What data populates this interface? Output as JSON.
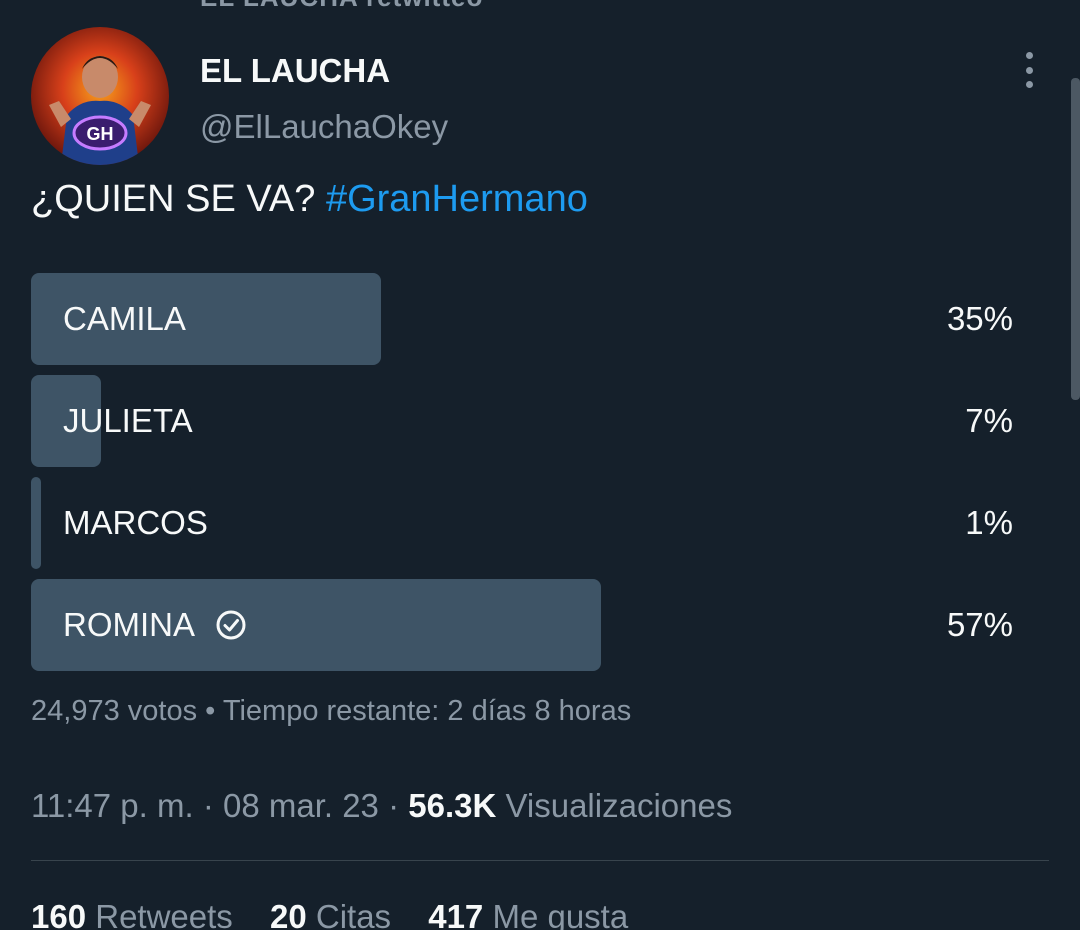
{
  "header_cut_text": "EL LAUCHA retwitteó",
  "author": {
    "display_name": "EL LAUCHA",
    "handle": "@ElLauchaOkey",
    "avatar_badge": "GH"
  },
  "tweet": {
    "text": "¿QUIEN SE VA? ",
    "hashtag": "#GranHermano"
  },
  "poll": {
    "options": [
      {
        "label": "CAMILA",
        "percent_text": "35%",
        "percent": 35,
        "winner": false
      },
      {
        "label": "JULIETA",
        "percent_text": "7%",
        "percent": 7,
        "winner": false
      },
      {
        "label": "MARCOS",
        "percent_text": "1%",
        "percent": 1,
        "winner": false
      },
      {
        "label": "ROMINA",
        "percent_text": "57%",
        "percent": 57,
        "winner": true
      }
    ],
    "votes": "24,973 votos",
    "separator": " • ",
    "time_remaining": "Tiempo restante: 2 días 8 horas"
  },
  "meta": {
    "time": "11:47 p. m.",
    "dot": " · ",
    "date": "08 mar. 23",
    "views_count": "56.3K",
    "views_label": "Visualizaciones"
  },
  "stats": {
    "retweets_count": "160",
    "retweets_label": "Retweets",
    "quotes_count": "20",
    "quotes_label": "Citas",
    "likes_count": "417",
    "likes_label": "Me gusta"
  },
  "colors": {
    "background": "#15202b",
    "poll_fill": "#3e5466",
    "link": "#1d9bf0",
    "secondary_text": "#8b98a5"
  }
}
